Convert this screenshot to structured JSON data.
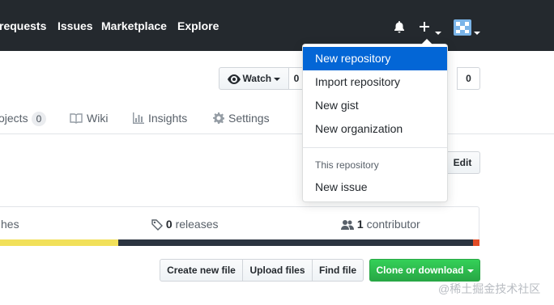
{
  "nav": {
    "links": [
      "requests",
      "Issues",
      "Marketplace",
      "Explore"
    ],
    "icons": [
      "bell-icon",
      "plus-icon",
      "avatar"
    ]
  },
  "repohead": {
    "watch_label": "Watch",
    "watch_count": "0",
    "fork_count": "0"
  },
  "tabs": {
    "projects_label": "ojects",
    "projects_count": "0",
    "wiki_label": "Wiki",
    "insights_label": "Insights",
    "settings_label": "Settings"
  },
  "edit_label": "Edit",
  "summary": {
    "branches_label": "hes",
    "releases_count": "0",
    "releases_label": "releases",
    "contributors_count": "1",
    "contributors_label": "contributor"
  },
  "language_colors": [
    "#f1e05a",
    "#2b3440",
    "#e34c26"
  ],
  "file_actions": {
    "create": "Create new file",
    "upload": "Upload files",
    "find": "Find file",
    "clone": "Clone or download"
  },
  "dropdown": {
    "items": [
      "New repository",
      "Import repository",
      "New gist",
      "New organization"
    ],
    "section_header": "This repository",
    "section_items": [
      "New issue"
    ]
  },
  "watermark": "@稀土掘金技术社区"
}
